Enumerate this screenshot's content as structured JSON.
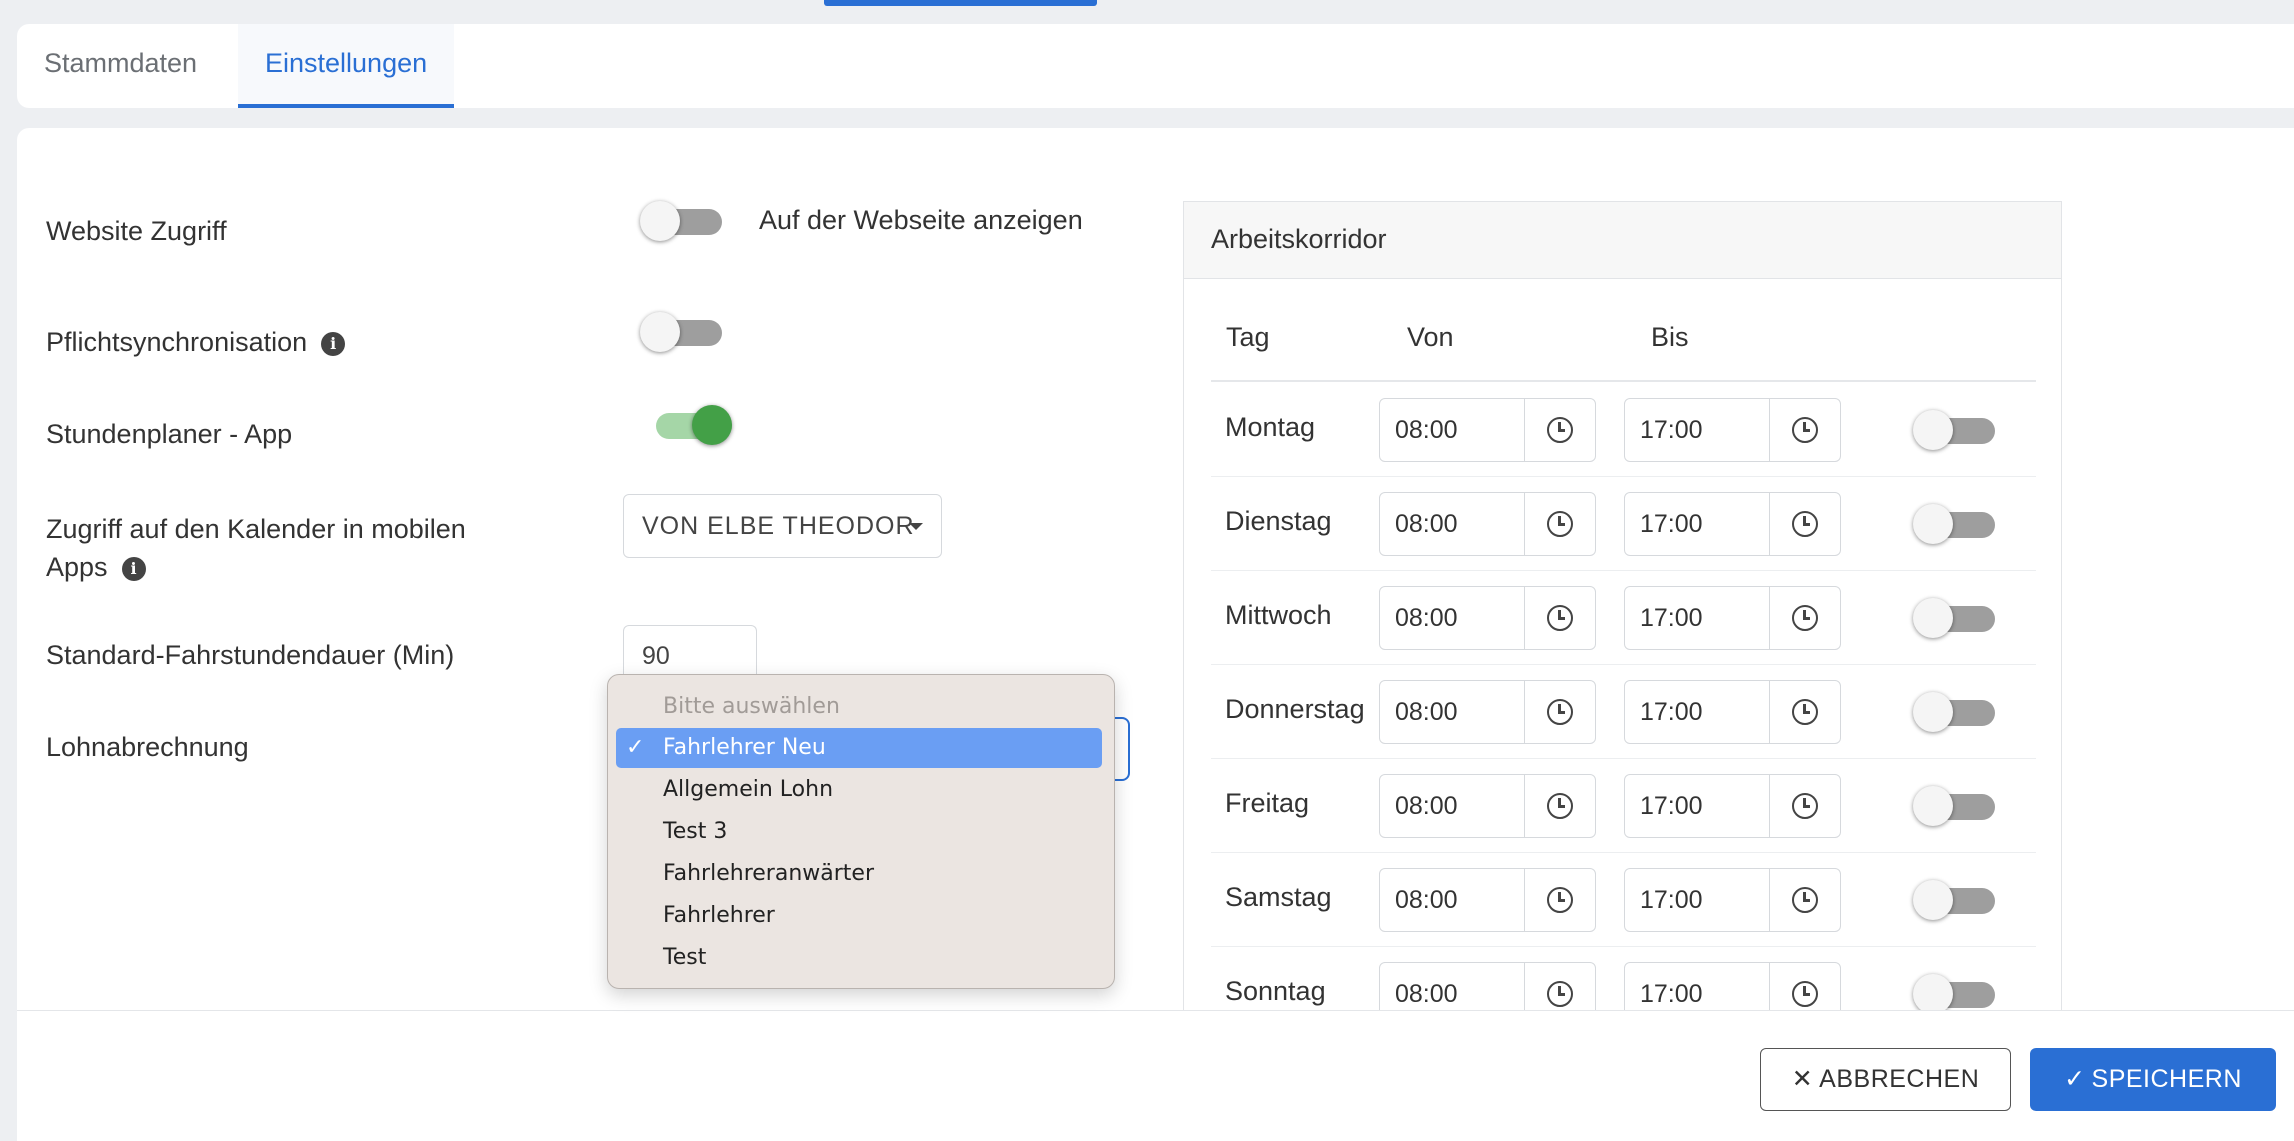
{
  "tabs": [
    {
      "label": "Stammdaten",
      "active": false
    },
    {
      "label": "Einstellungen",
      "active": true
    }
  ],
  "settings": {
    "website_zugriff": {
      "label": "Website Zugriff",
      "toggle_on": false,
      "right_text": "Auf der Webseite anzeigen"
    },
    "pflichtsync": {
      "label": "Pflichtsynchronisation",
      "toggle_on": false
    },
    "stundenplaner": {
      "label": "Stundenplaner - App",
      "toggle_on": true
    },
    "kalender": {
      "label_line1": "Zugriff auf den Kalender in mobilen",
      "label_line2": "Apps",
      "select_value": "VON ELBE THEODOR"
    },
    "fahrstundendauer": {
      "label": "Standard-Fahrstundendauer (Min)",
      "value": "90"
    },
    "lohnabrechnung": {
      "label": "Lohnabrechnung"
    }
  },
  "dropdown": {
    "placeholder": "Bitte auswählen",
    "options": [
      "Fahrlehrer Neu",
      "Allgemein Lohn",
      "Test 3",
      "Fahrlehreranwärter",
      "Fahrlehrer",
      "Test"
    ],
    "selected": "Fahrlehrer Neu"
  },
  "arbeitskorridor": {
    "title": "Arbeitskorridor",
    "headers": {
      "tag": "Tag",
      "von": "Von",
      "bis": "Bis"
    },
    "days": [
      {
        "tag": "Montag",
        "von": "08:00",
        "bis": "17:00",
        "enabled": false
      },
      {
        "tag": "Dienstag",
        "von": "08:00",
        "bis": "17:00",
        "enabled": false
      },
      {
        "tag": "Mittwoch",
        "von": "08:00",
        "bis": "17:00",
        "enabled": false
      },
      {
        "tag": "Donnerstag",
        "von": "08:00",
        "bis": "17:00",
        "enabled": false
      },
      {
        "tag": "Freitag",
        "von": "08:00",
        "bis": "17:00",
        "enabled": false
      },
      {
        "tag": "Samstag",
        "von": "08:00",
        "bis": "17:00",
        "enabled": false
      },
      {
        "tag": "Sonntag",
        "von": "08:00",
        "bis": "17:00",
        "enabled": false
      }
    ]
  },
  "footer": {
    "cancel": "ABBRECHEN",
    "save": "SPEICHERN"
  },
  "colors": {
    "accent": "#2a6fd4",
    "toggle_on": "#43a047",
    "selected_option": "#6a9ef3"
  }
}
